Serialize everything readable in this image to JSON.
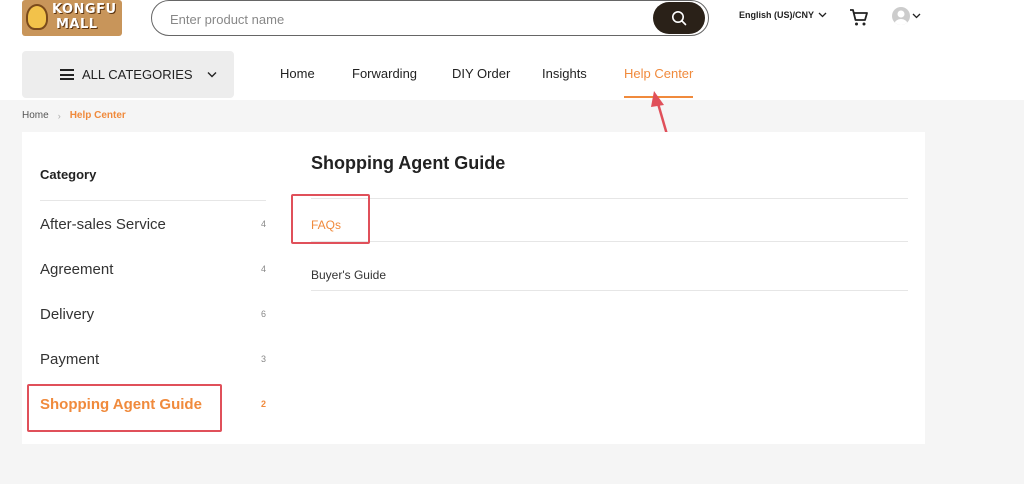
{
  "header": {
    "logo_line1": "KONGFU",
    "logo_line2": "MALL",
    "search_placeholder": "Enter product name",
    "language": "English (US)/CNY"
  },
  "categories_button": {
    "label": "ALL CATEGORIES"
  },
  "nav": {
    "items": [
      {
        "label": "Home"
      },
      {
        "label": "Forwarding"
      },
      {
        "label": "DIY Order"
      },
      {
        "label": "Insights"
      },
      {
        "label": "Help Center"
      }
    ]
  },
  "breadcrumb": {
    "home": "Home",
    "current": "Help Center"
  },
  "sidebar": {
    "title": "Category",
    "items": [
      {
        "label": "After-sales Service",
        "count": "4"
      },
      {
        "label": "Agreement",
        "count": "4"
      },
      {
        "label": "Delivery",
        "count": "6"
      },
      {
        "label": "Payment",
        "count": "3"
      },
      {
        "label": "Shopping Agent Guide",
        "count": "2"
      }
    ]
  },
  "main": {
    "title": "Shopping Agent Guide",
    "articles": [
      {
        "label": "FAQs"
      },
      {
        "label": "Buyer's Guide"
      }
    ]
  },
  "colors": {
    "accent": "#f08a3c",
    "highlight": "#e0505a",
    "search_button": "#2a2118"
  }
}
